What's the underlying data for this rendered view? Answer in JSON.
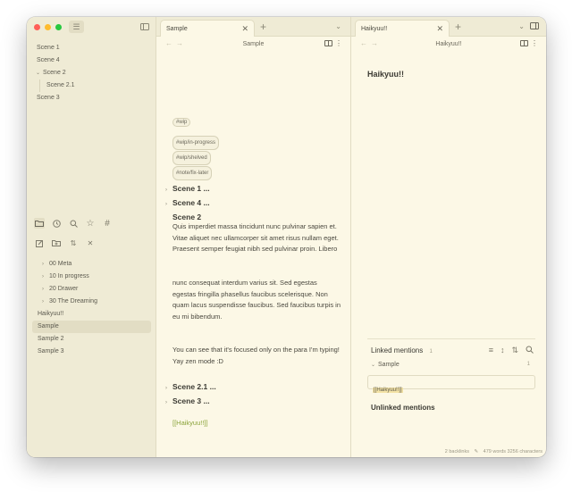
{
  "window": {
    "traffic_colors": [
      "#ff5f57",
      "#febc2e",
      "#28c840"
    ]
  },
  "sidebar": {
    "outline": [
      "Scene 1",
      "Scene 4",
      "Scene 2",
      "Scene 2.1",
      "Scene 3"
    ],
    "files": [
      "00 Meta",
      "10 In progress",
      "20 Drawer",
      "30 The Dreaming",
      "Haikyuu!!",
      "Sample",
      "Sample 2",
      "Sample 3"
    ]
  },
  "left_pane": {
    "tab_title": "Sample",
    "nav_title": "Sample",
    "tags": [
      "#wip",
      "#wip/in-progress",
      "#wip/shelved",
      "#note/fix-later"
    ],
    "collapsed_1": "Scene 1",
    "collapsed_2": "Scene 4",
    "ellipsis": "...",
    "scene2_heading": "Scene 2",
    "para1": "Quis imperdiet massa tincidunt nunc pulvinar sapien et. Vitae aliquet nec ullamcorper sit amet risus nullam eget. Praesent semper feugiat nibh sed pulvinar proin. Libero",
    "para2": "nunc consequat interdum varius sit. Sed egestas egestas fringilla phasellus faucibus scelerisque. Non quam lacus suspendisse faucibus. Sed faucibus turpis in eu mi bibendum.",
    "para3": "You can see that it's focused only on the para I'm typing! Yay zen mode :D",
    "collapsed_3": "Scene 2.1",
    "collapsed_4": "Scene 3",
    "link": "[[Haikyuu!!]]"
  },
  "right_pane": {
    "tab_title": "Haikyuu!!",
    "nav_title": "Haikyuu!!",
    "doc_title": "Haikyuu!!",
    "linked_mentions_label": "Linked mentions",
    "linked_count": "1",
    "ref_file": "Sample",
    "ref_count": "1",
    "ref_snippet": "[[Haikyuu!!]]",
    "unlinked_label": "Unlinked mentions",
    "status_backlinks": "2 backlinks",
    "status_counts": "479 words  3256 characters"
  }
}
